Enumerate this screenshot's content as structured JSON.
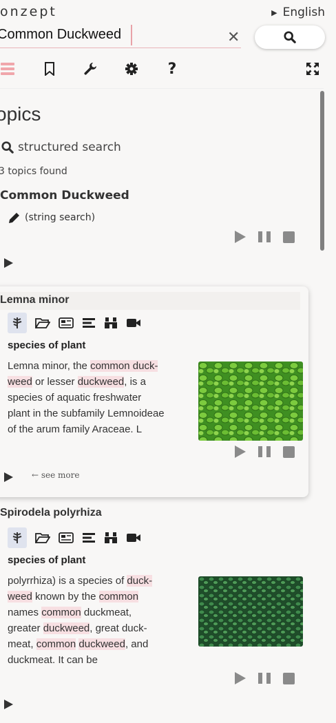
{
  "brand": "onzept",
  "language": "English",
  "search": {
    "value": "Common Duckweed"
  },
  "heading": "opics",
  "structured_search": "structured search",
  "topics_found": "3 topics found",
  "query_title": "Common Duckweed",
  "string_search": "(string search)",
  "cards": [
    {
      "title": "Lemna minor",
      "description_label": "species of plant",
      "lines": [
        [
          "Lemna minor, the ",
          {
            "hl": "common duck-"
          }
        ],
        [
          {
            "hl": "weed"
          },
          " or lesser ",
          {
            "hl": "duckweed"
          },
          ", is a"
        ],
        [
          "species of aquatic freshwater"
        ],
        [
          "plant in the subfamily Lemnoideae"
        ],
        [
          "of the arum family Araceae. L"
        ]
      ],
      "see_more": "see more"
    },
    {
      "title": "Spirodela polyrhiza",
      "description_label": "species of plant",
      "lines": [
        [
          "polyrrhiza) is a species of ",
          {
            "hl": "duck-"
          }
        ],
        [
          {
            "hl": "weed"
          },
          " known by the ",
          {
            "hl": "common"
          }
        ],
        [
          "names ",
          {
            "hl": "common"
          },
          " duckmeat,"
        ],
        [
          "greater ",
          {
            "hl": "duckweed"
          },
          ", great duck-"
        ],
        [
          "meat, ",
          {
            "hl": "common"
          },
          " ",
          {
            "hl": "duckweed"
          },
          ", and"
        ],
        [
          "duckmeat. It can be"
        ]
      ]
    }
  ],
  "colors": {
    "accent": "#f0a6ab",
    "highlight": "#f7dfe2",
    "icon": "#333333"
  },
  "icons": [
    "menu-icon",
    "bookmark-icon",
    "wrench-icon",
    "gear-icon",
    "help-icon",
    "fullscreen-icon",
    "search-icon",
    "close-icon",
    "pencil-icon",
    "plant-icon",
    "folder-icon",
    "newspaper-icon",
    "list-icon",
    "binoculars-icon",
    "video-icon"
  ]
}
